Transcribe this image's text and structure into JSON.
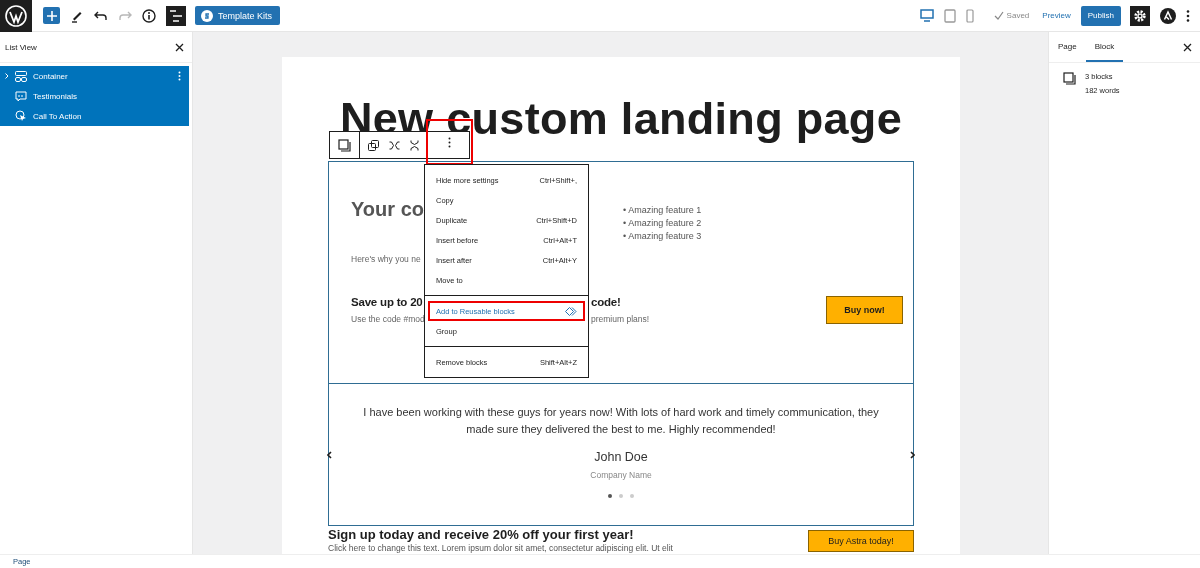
{
  "topbar": {
    "template_kits": "Template Kits",
    "saved": "Saved",
    "preview": "Preview",
    "publish": "Publish",
    "list_view_open": true,
    "settings_open": true
  },
  "devices": [
    {
      "kind": "desktop",
      "selected": true
    },
    {
      "kind": "tablet",
      "selected": false
    },
    {
      "kind": "mobile",
      "selected": false
    }
  ],
  "list_view": {
    "title": "List View",
    "items": [
      {
        "label": "Container",
        "kind": "container",
        "expandable": true,
        "selected": true
      },
      {
        "label": "Testimonials",
        "kind": "quote",
        "expandable": false,
        "selected": true
      },
      {
        "label": "Call To Action",
        "kind": "cta",
        "expandable": false,
        "selected": true
      }
    ]
  },
  "page": {
    "title": "New custom landing page",
    "hero": {
      "heading": "Your co",
      "intro": "Here's why you ne",
      "features": [
        "• Amazing feature 1",
        "• Amazing feature 2",
        "• Amazing feature 3"
      ],
      "offer_heading_start": "Save up to 20",
      "offer_heading_end": "code!",
      "offer_text_start": "Use the code #mod",
      "offer_text_end": "premium plans!",
      "button": "Buy now!"
    },
    "testimonial": {
      "quote": "I have been working with these guys for years now! With lots of hard work and timely communication, they made sure they delivered the best to me. Highly recommended!",
      "name": "John Doe",
      "company": "Company Name",
      "dots": [
        {
          "selected": true
        },
        {
          "selected": false
        },
        {
          "selected": false
        }
      ]
    },
    "cta": {
      "heading": "Sign up today and receive 20% off your first year!",
      "text": "Click here to change this text. Lorem ipsum dolor sit amet, consectetur adipiscing elit. Ut elit",
      "button": "Buy Astra today!"
    }
  },
  "block_menu": {
    "more_highlighted": true,
    "groups": [
      [
        {
          "label": "Hide more settings",
          "shortcut": "Ctrl+Shift+,",
          "highlighted": false
        },
        {
          "label": "Copy",
          "highlighted": false
        },
        {
          "label": "Duplicate",
          "shortcut": "Ctrl+Shift+D",
          "highlighted": false
        },
        {
          "label": "Insert before",
          "shortcut": "Ctrl+Alt+T",
          "highlighted": false
        },
        {
          "label": "Insert after",
          "shortcut": "Ctrl+Alt+Y",
          "highlighted": false
        },
        {
          "label": "Move to",
          "highlighted": false
        }
      ],
      [
        {
          "label": "Add to Reusable blocks",
          "highlighted": true
        },
        {
          "label": "Group",
          "highlighted": false
        }
      ],
      [
        {
          "label": "Remove blocks",
          "shortcut": "Shift+Alt+Z",
          "highlighted": false
        }
      ]
    ]
  },
  "inspector": {
    "tabs": [
      {
        "label": "Page",
        "selected": false
      },
      {
        "label": "Block",
        "selected": true
      }
    ],
    "blocks": "3 blocks",
    "words": "182 words"
  },
  "status_bar": {
    "breadcrumb": "Page"
  }
}
